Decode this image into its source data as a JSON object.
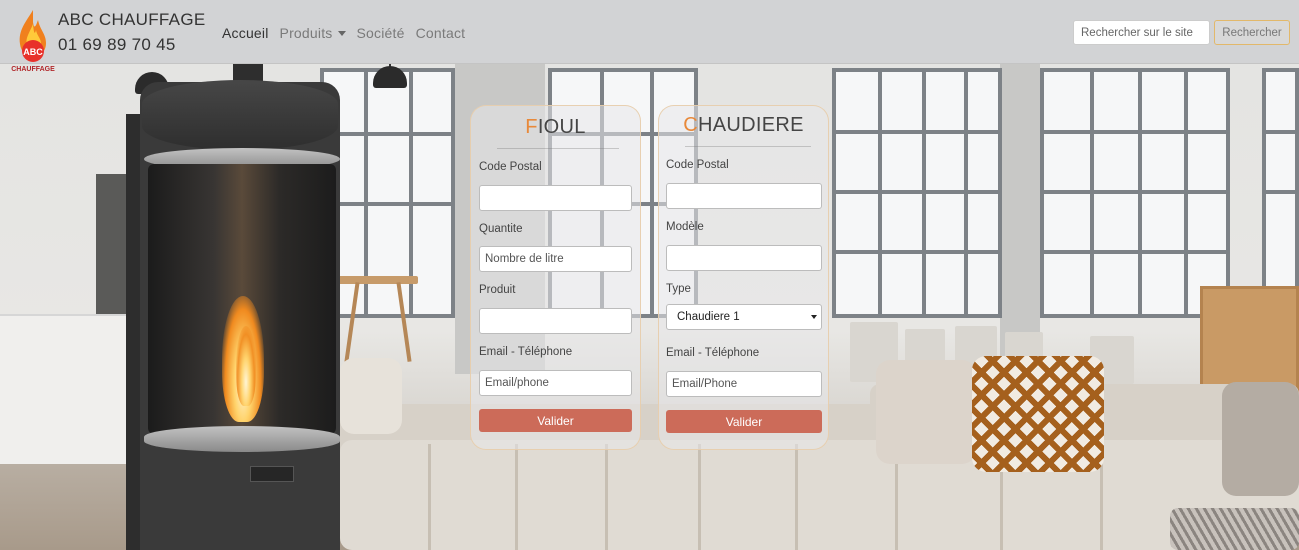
{
  "brand": {
    "name": "ABC CHAUFFAGE",
    "phone": "01 69 89 70 45",
    "logo_text_abc": "ABC",
    "logo_text_arc": "CHAUFFAGE"
  },
  "nav": {
    "items": [
      {
        "label": "Accueil",
        "active": true
      },
      {
        "label": "Produits",
        "has_dropdown": true
      },
      {
        "label": "Société"
      },
      {
        "label": "Contact"
      }
    ]
  },
  "search": {
    "placeholder": "Rechercher sur le site",
    "button_label": "Rechercher"
  },
  "colors": {
    "accent_orange": "#e8893a",
    "submit_button": "#cc6b59",
    "navbar_bg": "#d2d3d5"
  },
  "fioul_form": {
    "title_first": "F",
    "title_rest": "IOUL",
    "fields": {
      "code_postal": {
        "label": "Code Postal",
        "value": "",
        "placeholder": ""
      },
      "quantite": {
        "label": "Quantite",
        "value": "",
        "placeholder": "Nombre de litre"
      },
      "produit": {
        "label": "Produit",
        "value": "",
        "placeholder": ""
      },
      "email": {
        "label": "Email - Téléphone",
        "value": "",
        "placeholder": "Email/phone"
      }
    },
    "submit_label": "Valider"
  },
  "chaudiere_form": {
    "title_first": "C",
    "title_rest": "HAUDIERE",
    "fields": {
      "code_postal": {
        "label": "Code Postal",
        "value": "",
        "placeholder": ""
      },
      "modele": {
        "label": "Modèle",
        "value": "",
        "placeholder": ""
      },
      "type": {
        "label": "Type",
        "selected": "Chaudiere 1"
      },
      "email": {
        "label": "Email - Téléphone",
        "value": "",
        "placeholder": "Email/Phone"
      }
    },
    "submit_label": "Valider"
  }
}
